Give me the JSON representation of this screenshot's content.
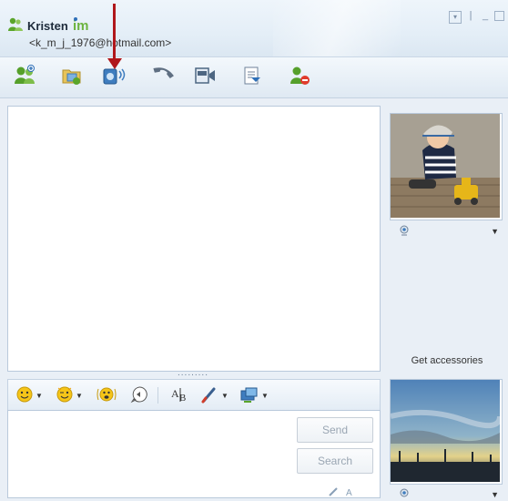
{
  "window": {
    "contact_name": "Kristen",
    "contact_email": "<k_m_j_1976@hotmail.com>",
    "controls": [
      "▾",
      "|",
      "_",
      "□"
    ]
  },
  "toolbar": {
    "items": [
      {
        "icon": "invite-contact-icon"
      },
      {
        "icon": "send-files-icon"
      },
      {
        "icon": "webcam-icon"
      },
      {
        "icon": "call-icon"
      },
      {
        "icon": "video-call-icon"
      },
      {
        "icon": "share-folder-icon"
      },
      {
        "icon": "block-contact-icon"
      }
    ]
  },
  "conversation": {
    "divider": "........."
  },
  "format_bar": {
    "items": [
      "emoticon-icon",
      "wink-icon",
      "nudge-icon",
      "voice-clip-icon",
      "font-icon",
      "background-icon",
      "games-icon"
    ]
  },
  "compose": {
    "send_label": "Send",
    "search_label": "Search"
  },
  "sidebar": {
    "get_accessories": "Get accessories"
  },
  "colors": {
    "accent_arrow": "#b0171b",
    "frame_border": "#b9c9db",
    "toolbar_bg": "#e4edf6"
  }
}
